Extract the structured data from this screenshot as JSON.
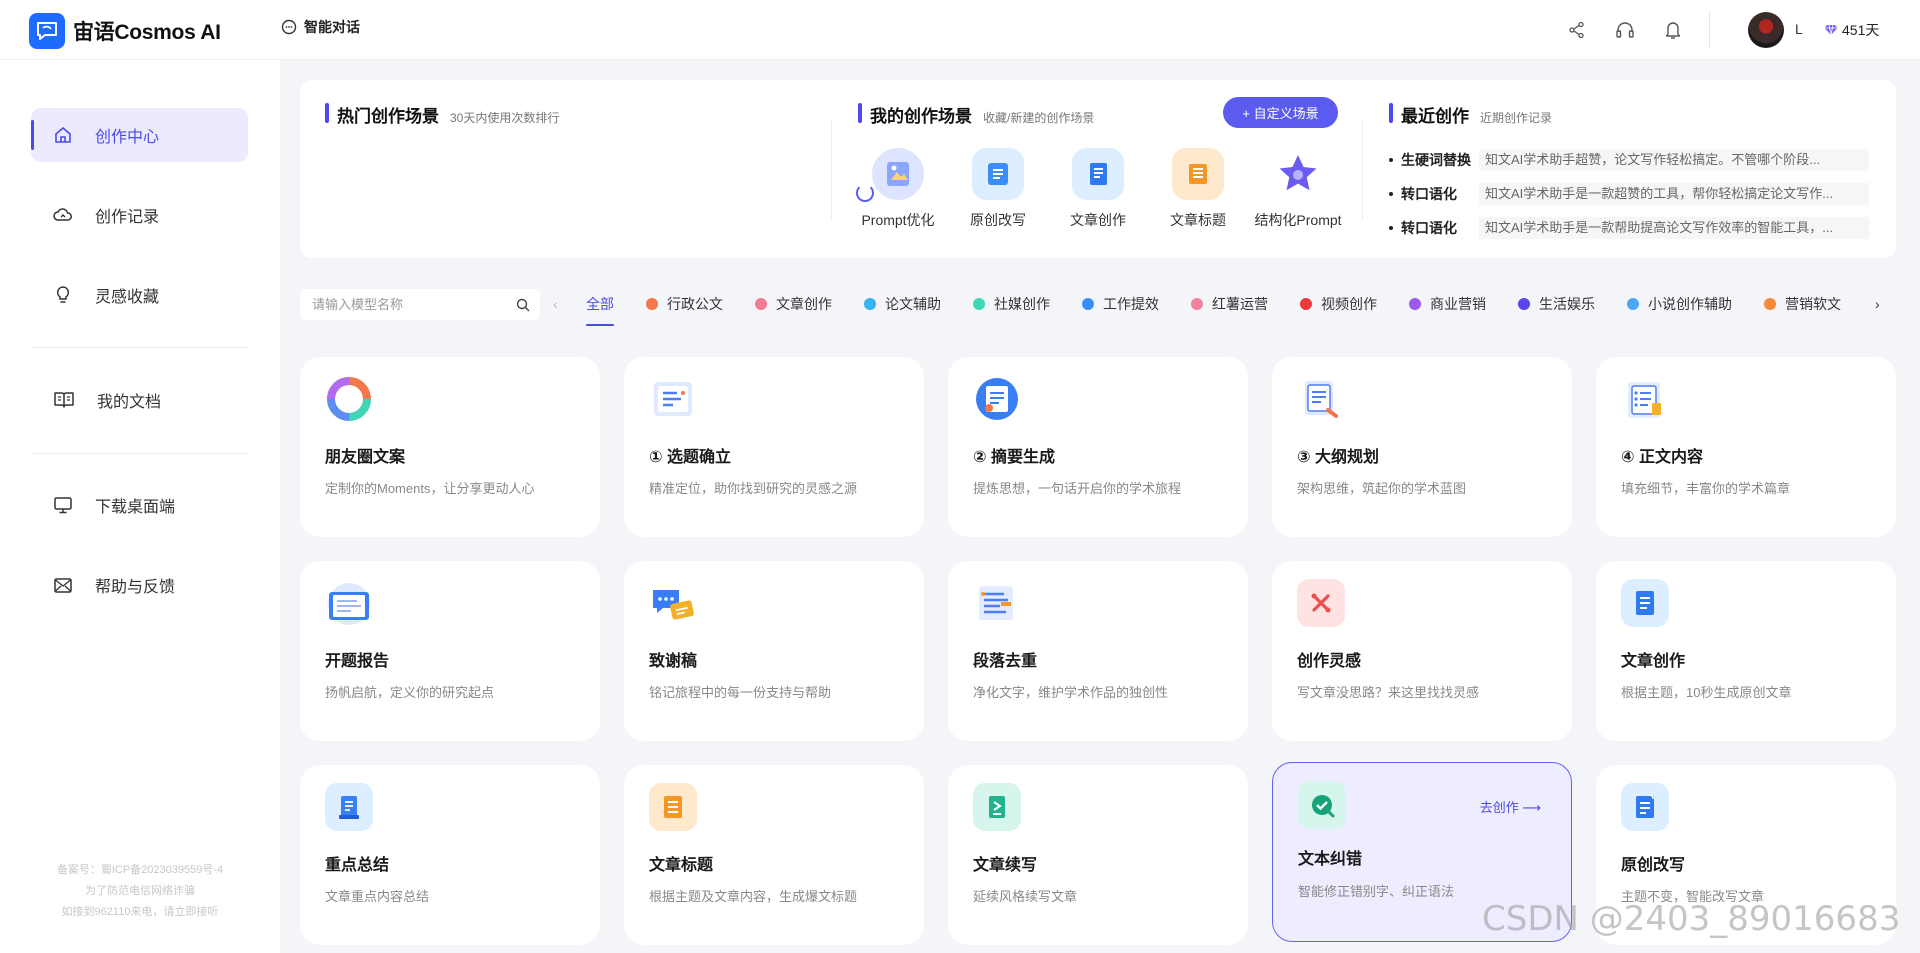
{
  "header": {
    "brand": "宙语Cosmos AI",
    "chat_label": "智能对话",
    "user_name": "L",
    "vip_days": "451天"
  },
  "sidebar": {
    "items": [
      {
        "label": "创作中心",
        "icon": "home-icon",
        "active": true
      },
      {
        "label": "创作记录",
        "icon": "cloud-icon"
      },
      {
        "label": "灵感收藏",
        "icon": "bulb-icon"
      },
      {
        "label": "我的文档",
        "icon": "book-icon"
      },
      {
        "label": "下载桌面端",
        "icon": "monitor-icon"
      },
      {
        "label": "帮助与反馈",
        "icon": "mail-icon"
      }
    ],
    "footnote": [
      "备案号：蜀ICP备2023039559号-4",
      "为了防范电信网络诈骗",
      "如接到962110来电，请立即接听"
    ]
  },
  "hot": {
    "title": "热门创作场景",
    "subtitle": "30天内使用次数排行"
  },
  "mine": {
    "title": "我的创作场景",
    "subtitle": "收藏/新建的创作场景",
    "custom_button": "+ 自定义场景",
    "scenes": [
      {
        "label": "Prompt优化",
        "icon": "prompt-icon"
      },
      {
        "label": "原创改写",
        "icon": "rewrite-icon"
      },
      {
        "label": "文章创作",
        "icon": "document-icon"
      },
      {
        "label": "文章标题",
        "icon": "title-icon"
      },
      {
        "label": "结构化Prompt",
        "icon": "star-icon"
      }
    ]
  },
  "recent": {
    "title": "最近创作",
    "subtitle": "近期创作记录",
    "items": [
      {
        "key": "生硬词替换",
        "text": "知文AI学术助手超赞，论文写作轻松搞定。不管哪个阶段..."
      },
      {
        "key": "转口语化",
        "text": "知文AI学术助手是一款超赞的工具，帮你轻松搞定论文写作..."
      },
      {
        "key": "转口语化",
        "text": "知文AI学术助手是一款帮助提高论文写作效率的智能工具，..."
      }
    ]
  },
  "filter": {
    "placeholder": "请输入模型名称",
    "categories": [
      {
        "label": "全部",
        "color": "",
        "active": true
      },
      {
        "label": "行政公文",
        "color": "#f2784b"
      },
      {
        "label": "文章创作",
        "color": "#f47a98"
      },
      {
        "label": "论文辅助",
        "color": "#37b3f0"
      },
      {
        "label": "社媒创作",
        "color": "#3fd6b8"
      },
      {
        "label": "工作提效",
        "color": "#3a8ef5"
      },
      {
        "label": "红薯运营",
        "color": "#f2809a"
      },
      {
        "label": "视频创作",
        "color": "#ec3a3a"
      },
      {
        "label": "商业营销",
        "color": "#9b59f0"
      },
      {
        "label": "生活娱乐",
        "color": "#5a45f0"
      },
      {
        "label": "小说创作辅助",
        "color": "#4aa7f5"
      },
      {
        "label": "营销软文",
        "color": "#f58a3a"
      }
    ]
  },
  "cards": [
    {
      "title": "朋友圈文案",
      "desc": "定制你的Moments，让分享更动人心",
      "icon": "moments-icon"
    },
    {
      "title": "① 选题确立",
      "desc": "精准定位，助你找到研究的灵感之源",
      "icon": "topic-icon"
    },
    {
      "title": "② 摘要生成",
      "desc": "提炼思想，一句话开启你的学术旅程",
      "icon": "abstract-icon"
    },
    {
      "title": "③ 大纲规划",
      "desc": "架构思维，筑起你的学术蓝图",
      "icon": "outline-icon"
    },
    {
      "title": "④ 正文内容",
      "desc": "填充细节，丰富你的学术篇章",
      "icon": "content-icon"
    },
    {
      "title": "开题报告",
      "desc": "扬帆启航，定义你的研究起点",
      "icon": "report-icon"
    },
    {
      "title": "致谢稿",
      "desc": "铭记旅程中的每一份支持与帮助",
      "icon": "thanks-icon"
    },
    {
      "title": "段落去重",
      "desc": "净化文字，维护学术作品的独创性",
      "icon": "dedupe-icon"
    },
    {
      "title": "创作灵感",
      "desc": "写文章没思路？来这里找找灵感",
      "icon": "inspiration-icon"
    },
    {
      "title": "文章创作",
      "desc": "根据主题，10秒生成原创文章",
      "icon": "document-icon"
    },
    {
      "title": "重点总结",
      "desc": "文章重点内容总结",
      "icon": "summary-icon"
    },
    {
      "title": "文章标题",
      "desc": "根据主题及文章内容，生成爆文标题",
      "icon": "title-icon"
    },
    {
      "title": "文章续写",
      "desc": "延续风格续写文章",
      "icon": "continue-icon"
    },
    {
      "title": "文本纠错",
      "desc": "智能修正错别字、纠正语法",
      "icon": "correct-icon",
      "hover": true,
      "action": "去创作 ⟶"
    },
    {
      "title": "原创改写",
      "desc": "主题不变，智能改写文章",
      "icon": "rewrite-icon"
    }
  ],
  "watermark": "CSDN @2403_89016683"
}
